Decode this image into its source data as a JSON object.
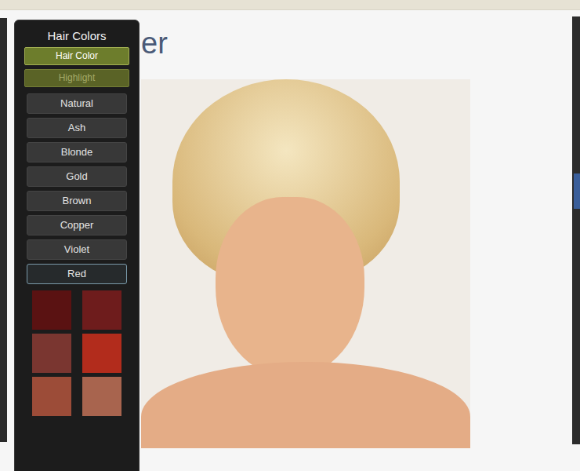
{
  "page": {
    "heading": "er"
  },
  "panel": {
    "title": "Hair Colors",
    "modes": [
      {
        "label": "Hair Color",
        "selected": true
      },
      {
        "label": "Highlight",
        "selected": false
      }
    ],
    "families": [
      {
        "label": "Natural",
        "selected": false
      },
      {
        "label": "Ash",
        "selected": false
      },
      {
        "label": "Blonde",
        "selected": false
      },
      {
        "label": "Gold",
        "selected": false
      },
      {
        "label": "Brown",
        "selected": false
      },
      {
        "label": "Copper",
        "selected": false
      },
      {
        "label": "Violet",
        "selected": false
      },
      {
        "label": "Red",
        "selected": true
      }
    ],
    "swatches": [
      {
        "color": "#5a1212"
      },
      {
        "color": "#6e1c1c"
      },
      {
        "color": "#7a3630"
      },
      {
        "color": "#b22c1c"
      },
      {
        "color": "#9c4c38"
      },
      {
        "color": "#a8644e"
      }
    ]
  }
}
